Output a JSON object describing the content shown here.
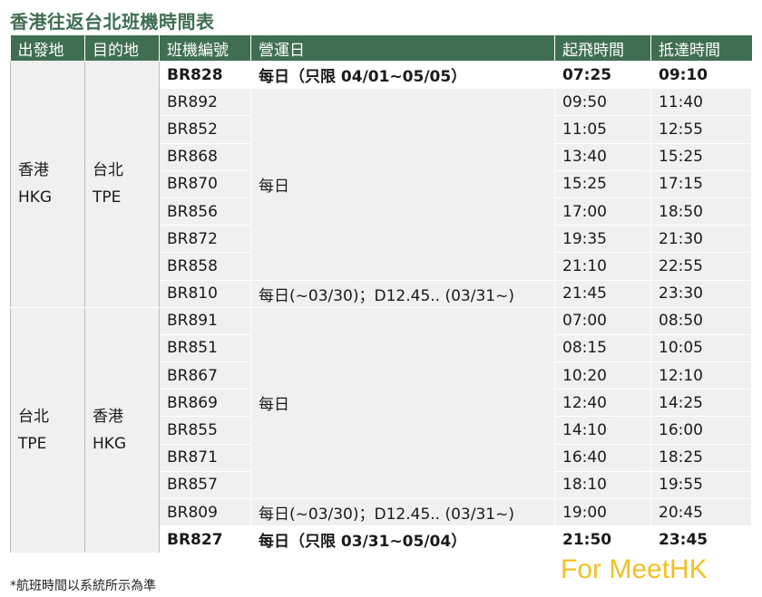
{
  "title": "香港往返台北班機時間表",
  "headers": [
    "出發地",
    "目的地",
    "班機編號",
    "營運日",
    "起飛時間",
    "抵達時間"
  ],
  "groups": [
    {
      "origin": [
        "香港",
        "HKG"
      ],
      "destination": [
        "台北",
        "TPE"
      ],
      "merged_day": "每日",
      "rows": [
        {
          "flight": "BR828",
          "day": "每日（只限 04/01~05/05）",
          "dep": "07:25",
          "arr": "09:10",
          "bold": true
        },
        {
          "flight": "BR892",
          "dep": "09:50",
          "arr": "11:40"
        },
        {
          "flight": "BR852",
          "dep": "11:05",
          "arr": "12:55"
        },
        {
          "flight": "BR868",
          "dep": "13:40",
          "arr": "15:25"
        },
        {
          "flight": "BR870",
          "dep": "15:25",
          "arr": "17:15"
        },
        {
          "flight": "BR856",
          "dep": "17:00",
          "arr": "18:50"
        },
        {
          "flight": "BR872",
          "dep": "19:35",
          "arr": "21:30"
        },
        {
          "flight": "BR858",
          "dep": "21:10",
          "arr": "22:55"
        },
        {
          "flight": "BR810",
          "day": "每日(~03/30)；D12.45.. (03/31~)",
          "dep": "21:45",
          "arr": "23:30"
        }
      ]
    },
    {
      "origin": [
        "台北",
        "TPE"
      ],
      "destination": [
        "香港",
        "HKG"
      ],
      "merged_day": "每日",
      "rows": [
        {
          "flight": "BR891",
          "dep": "07:00",
          "arr": "08:50"
        },
        {
          "flight": "BR851",
          "dep": "08:15",
          "arr": "10:05"
        },
        {
          "flight": "BR867",
          "dep": "10:20",
          "arr": "12:10"
        },
        {
          "flight": "BR869",
          "dep": "12:40",
          "arr": "14:25"
        },
        {
          "flight": "BR855",
          "dep": "14:10",
          "arr": "16:00"
        },
        {
          "flight": "BR871",
          "dep": "16:40",
          "arr": "18:25"
        },
        {
          "flight": "BR857",
          "dep": "18:10",
          "arr": "19:55"
        },
        {
          "flight": "BR809",
          "day": "每日(~03/30)；D12.45.. (03/31~)",
          "dep": "19:00",
          "arr": "20:45"
        },
        {
          "flight": "BR827",
          "day": "每日（只限 03/31~05/04）",
          "dep": "21:50",
          "arr": "23:45",
          "bold": true
        }
      ]
    }
  ],
  "footnote": "*航班時間以系統所示為準",
  "watermark": "For MeetHK",
  "colors": {
    "header_bg": "#3f6e53",
    "title": "#3f6e53",
    "row_gray": "#f0f0f0",
    "watermark": "#f2c026"
  }
}
